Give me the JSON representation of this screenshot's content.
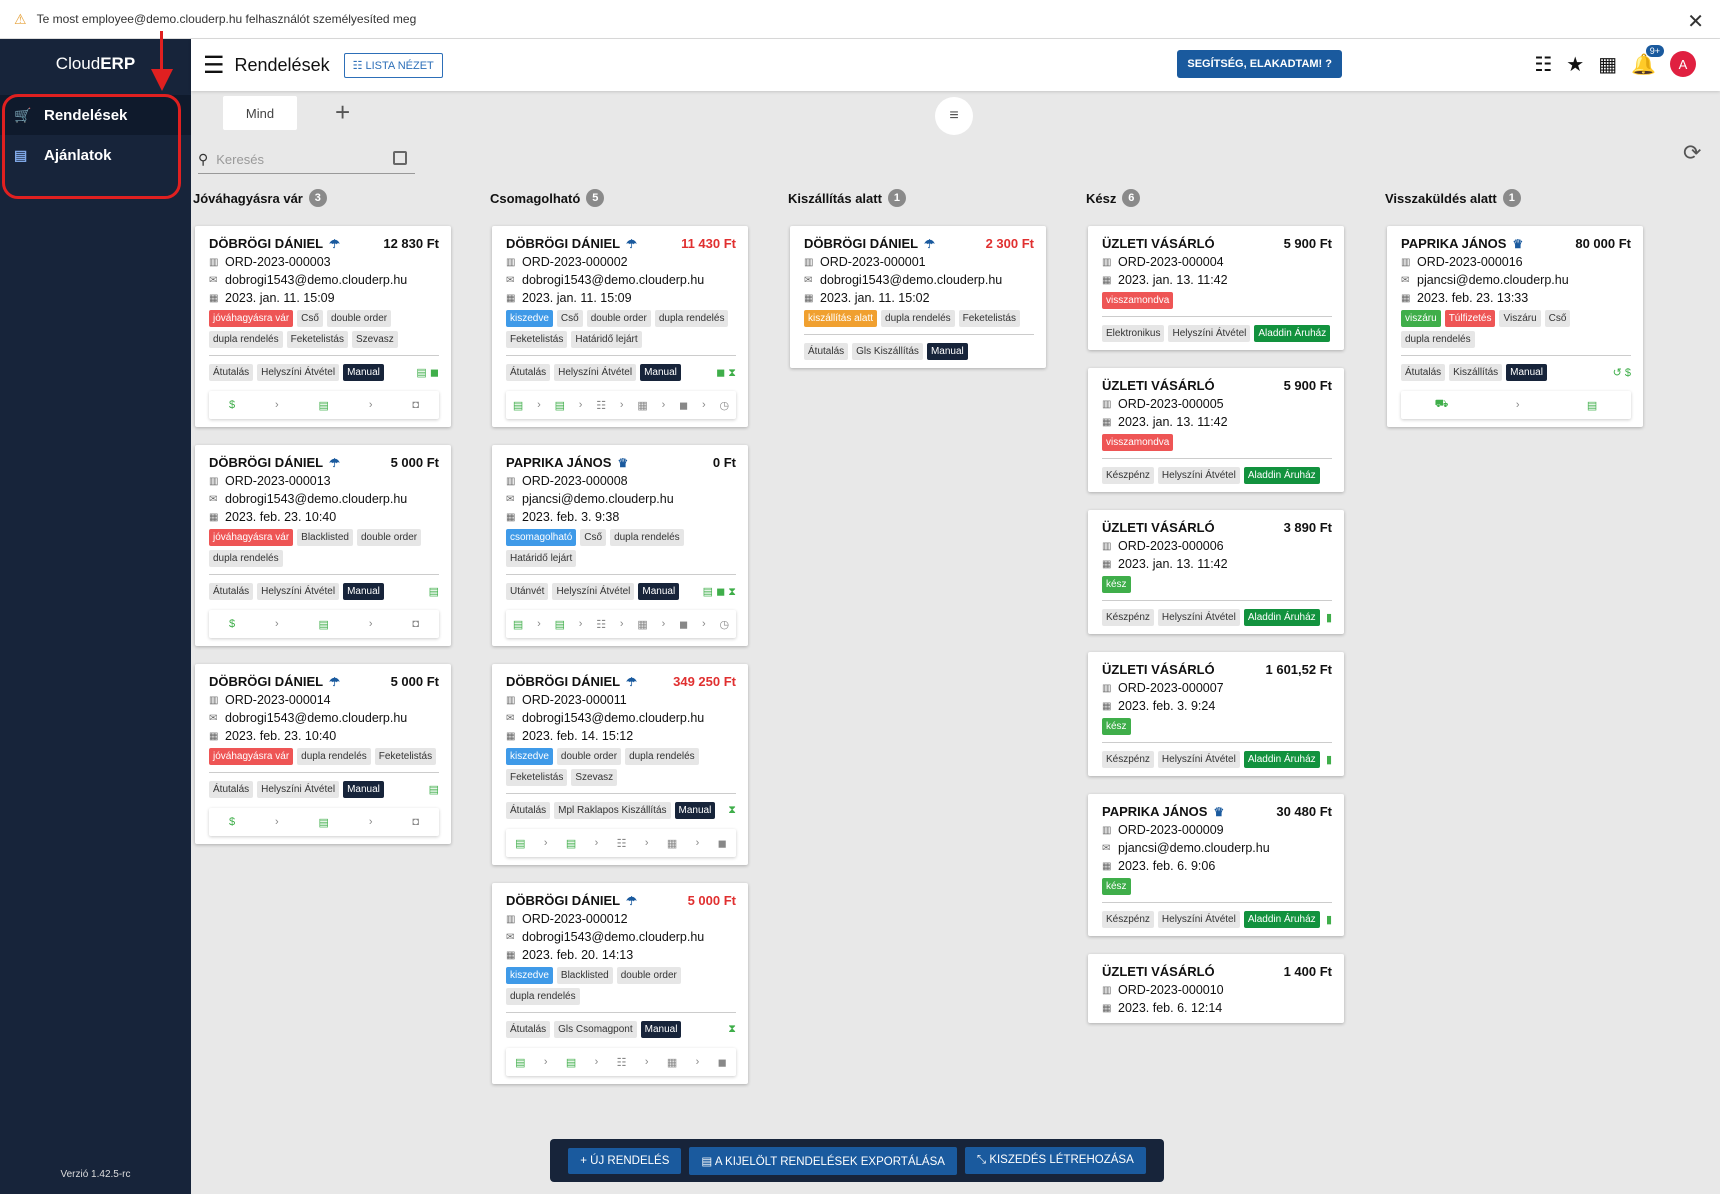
{
  "banner": {
    "text": "Te most employee@demo.clouderp.hu felhasználót személyesíted meg",
    "close": "✕"
  },
  "sidebar": {
    "logo_a": "Cloud",
    "logo_b": "ERP",
    "items": [
      {
        "label": "Rendelések",
        "icon": "cart-icon"
      },
      {
        "label": "Ajánlatok",
        "icon": "document-icon"
      }
    ],
    "version": "Verzió 1.42.5-rc"
  },
  "topbar": {
    "title": "Rendelések",
    "view_btn": "☷ LISTA NÉZET",
    "help_btn": "SEGÍTSÉG, ELAKADTAM! ?",
    "notif_badge": "9+",
    "avatar": "A"
  },
  "tabs": {
    "all": "Mind"
  },
  "search": {
    "placeholder": "Keresés"
  },
  "columns": [
    {
      "title": "Jóváhagyásra vár",
      "count": "3",
      "cards": [
        {
          "name": "DÖBRÖGI DÁNIEL",
          "icon": "umbrella",
          "amount": "12 830 Ft",
          "red": false,
          "id": "ORD-2023-000003",
          "email": "dobrogi1543@demo.clouderp.hu",
          "date": "2023. jan. 11. 15:09",
          "tags": [
            [
              "jóváhagyásra vár",
              "red"
            ],
            [
              "Cső",
              ""
            ],
            [
              "double order",
              ""
            ],
            [
              "dupla rendelés",
              ""
            ],
            [
              "Feketelistás",
              ""
            ],
            [
              "Szevasz",
              ""
            ]
          ],
          "pay": [
            [
              "Átutalás",
              ""
            ],
            [
              "Helyszíni Átvétel",
              ""
            ],
            [
              "Manual",
              "dark"
            ]
          ],
          "right": "▤ ◼",
          "steps": [
            "$",
            "›",
            "▤",
            "›",
            "◘"
          ]
        },
        {
          "name": "DÖBRÖGI DÁNIEL",
          "icon": "umbrella",
          "amount": "5 000 Ft",
          "red": false,
          "id": "ORD-2023-000013",
          "email": "dobrogi1543@demo.clouderp.hu",
          "date": "2023. feb. 23. 10:40",
          "tags": [
            [
              "jóváhagyásra vár",
              "red"
            ],
            [
              "Blacklisted",
              ""
            ],
            [
              "double order",
              ""
            ],
            [
              "dupla rendelés",
              ""
            ]
          ],
          "pay": [
            [
              "Átutalás",
              ""
            ],
            [
              "Helyszíni Átvétel",
              ""
            ],
            [
              "Manual",
              "dark"
            ]
          ],
          "right": "▤",
          "steps": [
            "$",
            "›",
            "▤",
            "›",
            "◘"
          ]
        },
        {
          "name": "DÖBRÖGI DÁNIEL",
          "icon": "umbrella",
          "amount": "5 000 Ft",
          "red": false,
          "id": "ORD-2023-000014",
          "email": "dobrogi1543@demo.clouderp.hu",
          "date": "2023. feb. 23. 10:40",
          "tags": [
            [
              "jóváhagyásra vár",
              "red"
            ],
            [
              "dupla rendelés",
              ""
            ],
            [
              "Feketelistás",
              ""
            ]
          ],
          "pay": [
            [
              "Átutalás",
              ""
            ],
            [
              "Helyszíni Átvétel",
              ""
            ],
            [
              "Manual",
              "dark"
            ]
          ],
          "right": "▤",
          "steps": [
            "$",
            "›",
            "▤",
            "›",
            "◘"
          ]
        }
      ]
    },
    {
      "title": "Csomagolható",
      "count": "5",
      "cards": [
        {
          "name": "DÖBRÖGI DÁNIEL",
          "icon": "umbrella",
          "amount": "11 430 Ft",
          "red": true,
          "id": "ORD-2023-000002",
          "email": "dobrogi1543@demo.clouderp.hu",
          "date": "2023. jan. 11. 15:09",
          "tags": [
            [
              "kiszedve",
              "blue"
            ],
            [
              "Cső",
              ""
            ],
            [
              "double order",
              ""
            ],
            [
              "dupla rendelés",
              ""
            ],
            [
              "Feketelistás",
              ""
            ],
            [
              "Határidő lejárt",
              ""
            ]
          ],
          "pay": [
            [
              "Átutalás",
              ""
            ],
            [
              "Helyszíni Átvétel",
              ""
            ],
            [
              "Manual",
              "dark"
            ]
          ],
          "right": "◼ ⧗",
          "steps": [
            "▤",
            "›",
            "▤",
            "›",
            "☷",
            "›",
            "▦",
            "›",
            "◼",
            "›",
            "◷"
          ]
        },
        {
          "name": "PAPRIKA JÁNOS",
          "icon": "crown",
          "amount": "0 Ft",
          "red": false,
          "id": "ORD-2023-000008",
          "email": "pjancsi@demo.clouderp.hu",
          "date": "2023. feb. 3. 9:38",
          "tags": [
            [
              "csomagolható",
              "blue"
            ],
            [
              "Cső",
              ""
            ],
            [
              "dupla rendelés",
              ""
            ],
            [
              "Határidő lejárt",
              ""
            ]
          ],
          "pay": [
            [
              "Utánvét",
              ""
            ],
            [
              "Helyszíni Átvétel",
              ""
            ],
            [
              "Manual",
              "dark"
            ]
          ],
          "right": "▤ ◼ ⧗",
          "steps": [
            "▤",
            "›",
            "▤",
            "›",
            "☷",
            "›",
            "▦",
            "›",
            "◼",
            "›",
            "◷"
          ]
        },
        {
          "name": "DÖBRÖGI DÁNIEL",
          "icon": "umbrella",
          "amount": "349 250 Ft",
          "red": true,
          "id": "ORD-2023-000011",
          "email": "dobrogi1543@demo.clouderp.hu",
          "date": "2023. feb. 14. 15:12",
          "tags": [
            [
              "kiszedve",
              "blue"
            ],
            [
              "double order",
              ""
            ],
            [
              "dupla rendelés",
              ""
            ],
            [
              "Feketelistás",
              ""
            ],
            [
              "Szevasz",
              ""
            ]
          ],
          "pay": [
            [
              "Átutalás",
              ""
            ],
            [
              "Mpl Raklapos Kiszállítás",
              ""
            ],
            [
              "Manual",
              "dark"
            ]
          ],
          "right": "⧗",
          "steps": [
            "▤",
            "›",
            "▤",
            "›",
            "☷",
            "›",
            "▦",
            "›",
            "◼"
          ]
        },
        {
          "name": "DÖBRÖGI DÁNIEL",
          "icon": "umbrella",
          "amount": "5 000 Ft",
          "red": true,
          "id": "ORD-2023-000012",
          "email": "dobrogi1543@demo.clouderp.hu",
          "date": "2023. feb. 20. 14:13",
          "tags": [
            [
              "kiszedve",
              "blue"
            ],
            [
              "Blacklisted",
              ""
            ],
            [
              "double order",
              ""
            ],
            [
              "dupla rendelés",
              ""
            ]
          ],
          "pay": [
            [
              "Átutalás",
              ""
            ],
            [
              "Gls Csomagpont",
              ""
            ],
            [
              "Manual",
              "dark"
            ]
          ],
          "right": "⧗",
          "steps": [
            "▤",
            "›",
            "▤",
            "›",
            "☷",
            "›",
            "▦",
            "›",
            "◼"
          ]
        }
      ]
    },
    {
      "title": "Kiszállítás alatt",
      "count": "1",
      "cards": [
        {
          "name": "DÖBRÖGI DÁNIEL",
          "icon": "umbrella",
          "amount": "2 300 Ft",
          "red": true,
          "id": "ORD-2023-000001",
          "email": "dobrogi1543@demo.clouderp.hu",
          "date": "2023. jan. 11. 15:02",
          "tags": [
            [
              "kiszállítás alatt",
              "orange"
            ],
            [
              "dupla rendelés",
              ""
            ],
            [
              "Feketelistás",
              ""
            ]
          ],
          "pay": [
            [
              "Átutalás",
              ""
            ],
            [
              "Gls Kiszállítás",
              ""
            ],
            [
              "Manual",
              "dark"
            ]
          ],
          "right": "",
          "steps": []
        }
      ]
    },
    {
      "title": "Kész",
      "count": "6",
      "cards": [
        {
          "name": "ÜZLETI VÁSÁRLÓ",
          "icon": "",
          "amount": "5 900 Ft",
          "red": false,
          "id": "ORD-2023-000004",
          "email": "",
          "date": "2023. jan. 13. 11:42",
          "tags": [
            [
              "visszamondva",
              "red"
            ]
          ],
          "pay": [
            [
              "Elektronikus",
              ""
            ],
            [
              "Helyszíni Átvétel",
              ""
            ],
            [
              "Aladdin Áruház",
              "dgreen"
            ]
          ],
          "right": "",
          "steps": []
        },
        {
          "name": "ÜZLETI VÁSÁRLÓ",
          "icon": "",
          "amount": "5 900 Ft",
          "red": false,
          "id": "ORD-2023-000005",
          "email": "",
          "date": "2023. jan. 13. 11:42",
          "tags": [
            [
              "visszamondva",
              "red"
            ]
          ],
          "pay": [
            [
              "Készpénz",
              ""
            ],
            [
              "Helyszíni Átvétel",
              ""
            ],
            [
              "Aladdin Áruház",
              "dgreen"
            ]
          ],
          "right": "",
          "steps": []
        },
        {
          "name": "ÜZLETI VÁSÁRLÓ",
          "icon": "",
          "amount": "3 890 Ft",
          "red": false,
          "id": "ORD-2023-000006",
          "email": "",
          "date": "2023. jan. 13. 11:42",
          "tags": [
            [
              "kész",
              "green"
            ]
          ],
          "pay": [
            [
              "Készpénz",
              ""
            ],
            [
              "Helyszíni Átvétel",
              ""
            ],
            [
              "Aladdin Áruház",
              "dgreen"
            ]
          ],
          "right": "▮",
          "steps": []
        },
        {
          "name": "ÜZLETI VÁSÁRLÓ",
          "icon": "",
          "amount": "1 601,52 Ft",
          "red": false,
          "id": "ORD-2023-000007",
          "email": "",
          "date": "2023. feb. 3. 9:24",
          "tags": [
            [
              "kész",
              "green"
            ]
          ],
          "pay": [
            [
              "Készpénz",
              ""
            ],
            [
              "Helyszíni Átvétel",
              ""
            ],
            [
              "Aladdin Áruház",
              "dgreen"
            ]
          ],
          "right": "▮",
          "steps": []
        },
        {
          "name": "PAPRIKA JÁNOS",
          "icon": "crown",
          "amount": "30 480 Ft",
          "red": false,
          "id": "ORD-2023-000009",
          "email": "pjancsi@demo.clouderp.hu",
          "date": "2023. feb. 6. 9:06",
          "tags": [
            [
              "kész",
              "green"
            ]
          ],
          "pay": [
            [
              "Készpénz",
              ""
            ],
            [
              "Helyszíni Átvétel",
              ""
            ],
            [
              "Aladdin Áruház",
              "dgreen"
            ]
          ],
          "right": "▮",
          "steps": []
        },
        {
          "name": "ÜZLETI VÁSÁRLÓ",
          "icon": "",
          "amount": "1 400 Ft",
          "red": false,
          "id": "ORD-2023-000010",
          "email": "",
          "date": "2023. feb. 6. 12:14",
          "tags": [],
          "pay": [],
          "right": "",
          "steps": []
        }
      ]
    },
    {
      "title": "Visszaküldés alatt",
      "count": "1",
      "cards": [
        {
          "name": "PAPRIKA JÁNOS",
          "icon": "crown",
          "amount": "80 000 Ft",
          "red": false,
          "id": "ORD-2023-000016",
          "email": "pjancsi@demo.clouderp.hu",
          "date": "2023. feb. 23. 13:33",
          "tags": [
            [
              "viszáru",
              "green"
            ],
            [
              "Túlfizetés",
              "red"
            ],
            [
              "Viszáru",
              ""
            ],
            [
              "Cső",
              ""
            ],
            [
              "dupla rendelés",
              ""
            ]
          ],
          "pay": [
            [
              "Átutalás",
              ""
            ],
            [
              "Kiszállítás",
              ""
            ],
            [
              "Manual",
              "dark"
            ]
          ],
          "right": "↺ $",
          "steps": [
            "⛟",
            "›",
            "▤"
          ]
        }
      ]
    }
  ],
  "bottom": {
    "new": "+ ÚJ RENDELÉS",
    "export": "▤ A KIJELÖLT RENDELÉSEK EXPORTÁLÁSA",
    "pick": "⤡ KISZEDÉS LÉTREHOZÁSA"
  }
}
